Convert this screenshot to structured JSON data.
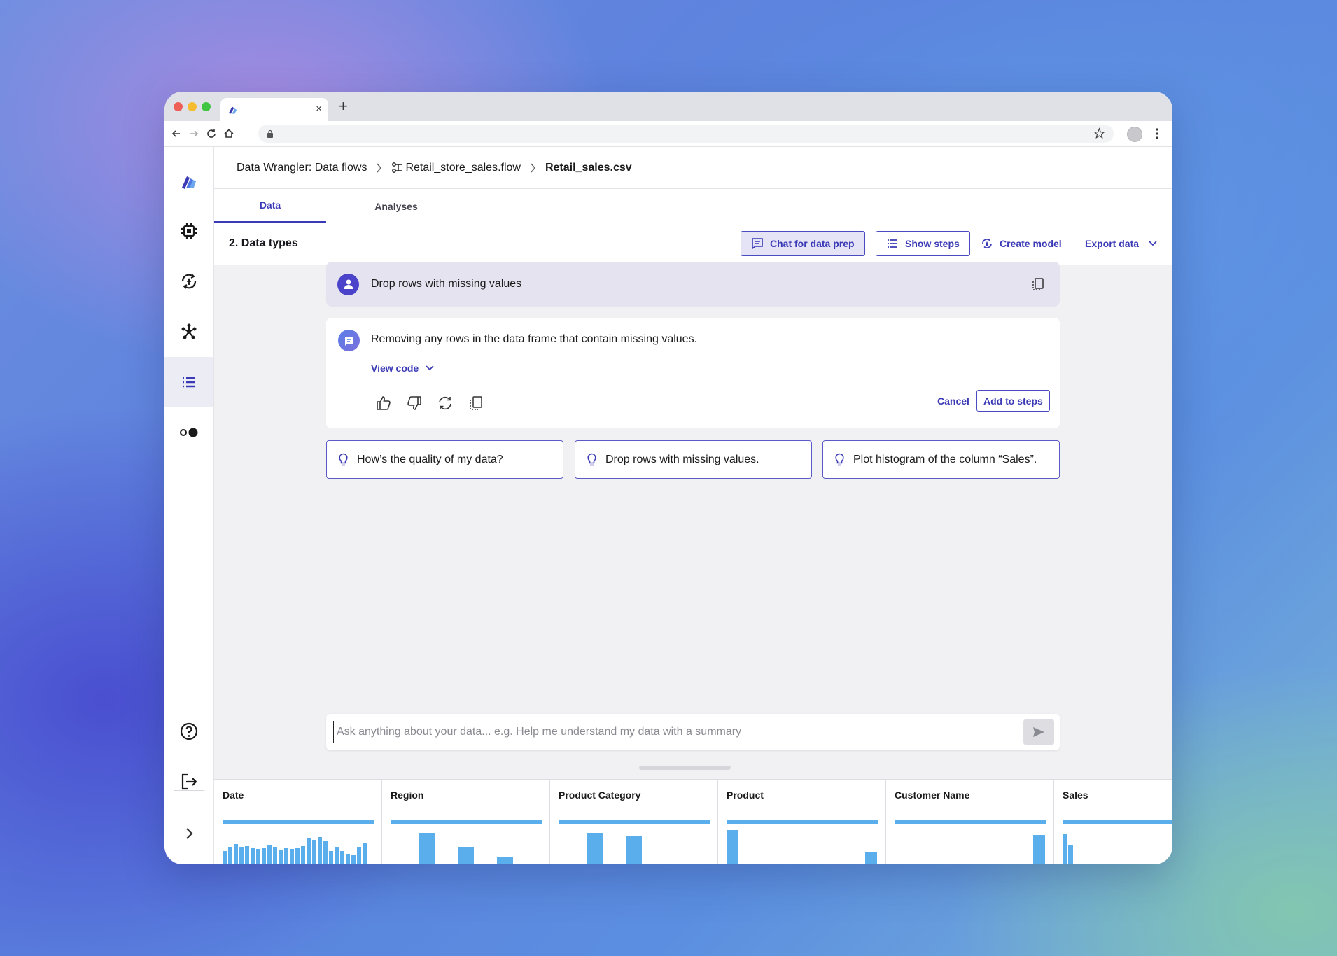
{
  "browser": {
    "new_tab": "+",
    "tab_close": "×"
  },
  "breadcrumb": {
    "root": "Data Wrangler: Data flows",
    "flow": "Retail_store_sales.flow",
    "file": "Retail_sales.csv"
  },
  "tabs": {
    "data": "Data",
    "analyses": "Analyses"
  },
  "toolbar": {
    "title": "2. Data types",
    "chat_btn": "Chat for data prep",
    "show_steps_btn": "Show steps",
    "create_model_btn": "Create model",
    "export_btn": "Export data"
  },
  "chat": {
    "user_message": "Drop rows with missing values",
    "ai_message": "Removing any rows in the data frame that contain missing values.",
    "view_code": "View code",
    "cancel": "Cancel",
    "add_to_steps": "Add to steps"
  },
  "suggestions": [
    "How’s the quality of my data?",
    "Drop rows with missing values.",
    "Plot histogram of the column “Sales”."
  ],
  "prompt": {
    "placeholder": "Ask anything about your data... e.g. Help me understand my data with a summary"
  },
  "columns": [
    "Date",
    "Region",
    "Product Category",
    "Product",
    "Customer Name",
    "Sales"
  ],
  "colors": {
    "accent": "#3b3ab6",
    "histogram": "#5aaeec"
  }
}
